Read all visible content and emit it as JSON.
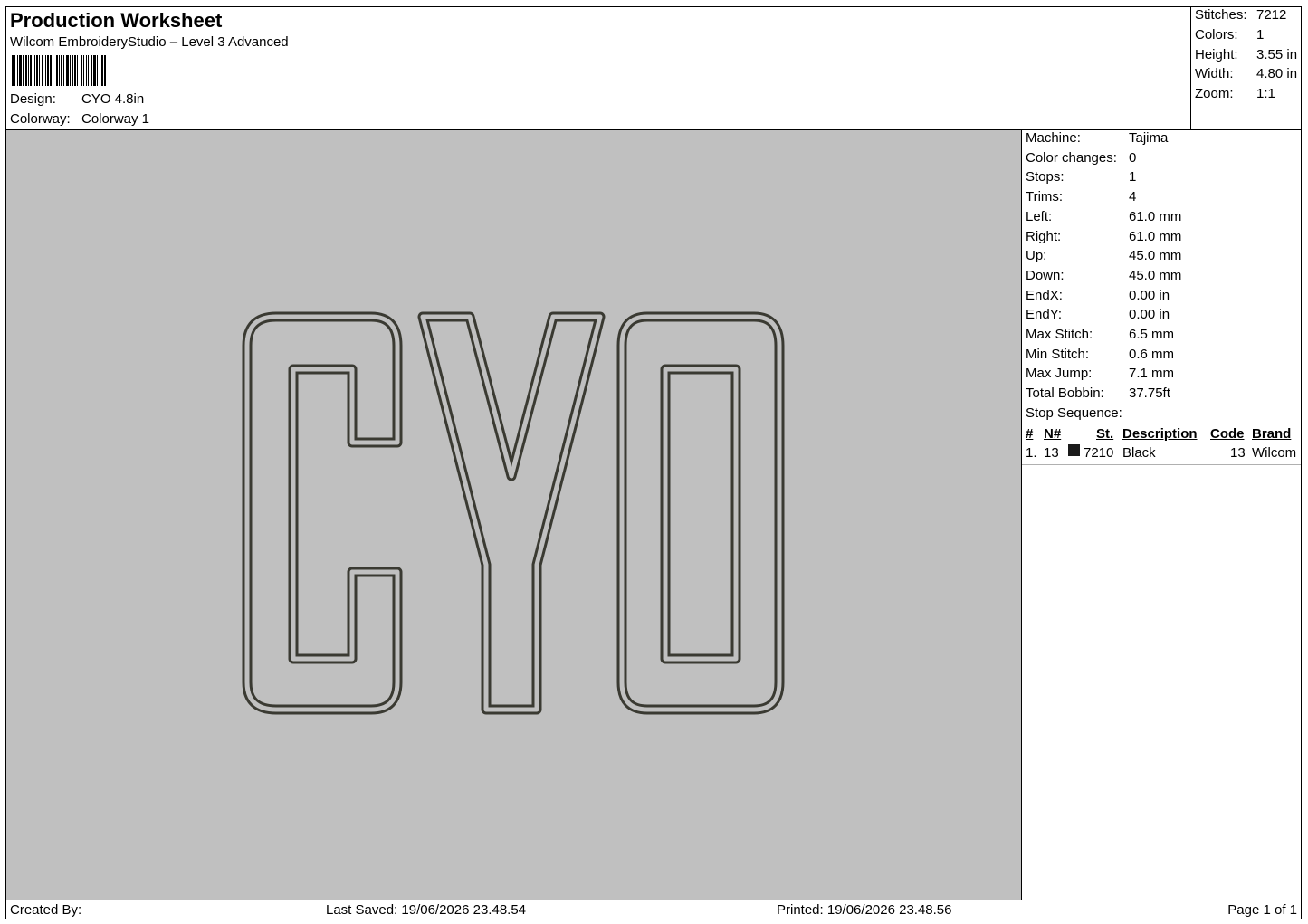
{
  "header": {
    "title": "Production Worksheet",
    "software": "Wilcom EmbroideryStudio – Level 3 Advanced",
    "design_label": "Design:",
    "design_value": "CYO 4.8in",
    "colorway_label": "Colorway:",
    "colorway_value": "Colorway 1"
  },
  "summary": [
    {
      "label": "Stitches:",
      "value": "7212"
    },
    {
      "label": "Colors:",
      "value": "1"
    },
    {
      "label": "Height:",
      "value": "3.55 in"
    },
    {
      "label": "Width:",
      "value": "4.80 in"
    },
    {
      "label": "Zoom:",
      "value": "1:1"
    }
  ],
  "design_preview": {
    "letters": "CYO",
    "thread_color": "#3a3a32",
    "background_color": "#c0c0c0"
  },
  "details": [
    {
      "label": "Machine:",
      "value": "Tajima"
    },
    {
      "label": "Color changes:",
      "value": "0"
    },
    {
      "label": "Stops:",
      "value": "1"
    },
    {
      "label": "Trims:",
      "value": "4"
    },
    {
      "label": "Left:",
      "value": "61.0 mm"
    },
    {
      "label": "Right:",
      "value": "61.0 mm"
    },
    {
      "label": "Up:",
      "value": "45.0 mm"
    },
    {
      "label": "Down:",
      "value": "45.0 mm"
    },
    {
      "label": "EndX:",
      "value": "0.00 in"
    },
    {
      "label": "EndY:",
      "value": "0.00 in"
    },
    {
      "label": "Max Stitch:",
      "value": "6.5 mm"
    },
    {
      "label": "Min Stitch:",
      "value": "0.6 mm"
    },
    {
      "label": "Max Jump:",
      "value": "7.1 mm"
    },
    {
      "label": "Total Bobbin:",
      "value": "37.75ft"
    }
  ],
  "stop_sequence": {
    "title": "Stop Sequence:",
    "headers": {
      "num": "#",
      "n": "N#",
      "st": "St.",
      "description": "Description",
      "code": "Code",
      "brand": "Brand"
    },
    "rows": [
      {
        "num": "1.",
        "n": "13",
        "swatch_color": "#1a1a1a",
        "st": "7210",
        "description": "Black",
        "code": "13",
        "brand": "Wilcom"
      }
    ]
  },
  "footer": {
    "created_by": "Created By:",
    "last_saved": "Last Saved: 19/06/2026 23.48.54",
    "printed": "Printed: 19/06/2026 23.48.56",
    "page": "Page 1 of 1"
  }
}
